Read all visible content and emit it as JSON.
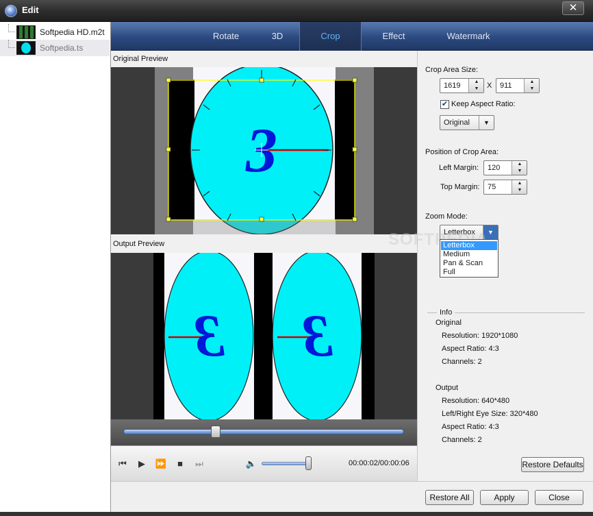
{
  "window": {
    "title": "Edit",
    "close_glyph": "✕"
  },
  "files": [
    {
      "name": "Softpedia HD.m2t",
      "thumb": "film-thumbnail"
    },
    {
      "name": "Softpedia.ts",
      "thumb": "clock-thumbnail"
    }
  ],
  "tabs": [
    {
      "label": "Rotate"
    },
    {
      "label": "3D"
    },
    {
      "label": "Crop",
      "active": true
    },
    {
      "label": "Effect"
    },
    {
      "label": "Watermark"
    }
  ],
  "preview": {
    "original_label": "Original Preview",
    "output_label": "Output Preview",
    "digit": "3",
    "seek_progress": 0.33,
    "volume_level": 0.95,
    "time": "00:00:02/00:00:06"
  },
  "crop": {
    "area_label": "Crop Area Size:",
    "width": "1619",
    "x_label": "X",
    "height": "911",
    "keep_aspect_label": "Keep Aspect Ratio:",
    "keep_aspect_checked": true,
    "aspect_value": "Original",
    "position_label": "Position of Crop Area:",
    "left_margin_label": "Left Margin:",
    "left_margin": "120",
    "top_margin_label": "Top Margin:",
    "top_margin": "75",
    "zoom_label": "Zoom Mode:",
    "zoom_value": "Letterbox",
    "zoom_options": [
      "Letterbox",
      "Medium",
      "Pan & Scan",
      "Full"
    ]
  },
  "info": {
    "title": "Info",
    "original_heading": "Original",
    "original": {
      "resolution": "Resolution: 1920*1080",
      "aspect": "Aspect Ratio: 4:3",
      "channels": "Channels: 2"
    },
    "output_heading": "Output",
    "output": {
      "resolution": "Resolution: 640*480",
      "eye_size": "Left/Right Eye Size: 320*480",
      "aspect": "Aspect Ratio: 4:3",
      "channels": "Channels: 2"
    }
  },
  "buttons": {
    "restore_defaults": "Restore Defaults",
    "restore_all": "Restore All",
    "apply": "Apply",
    "close": "Close"
  },
  "watermark_text": "SOFTPEDIA",
  "colors": {
    "accent": "#3399ff",
    "clock_face": "#00f0f8",
    "digit": "#0018d8",
    "hand": "#cc0000",
    "crop_frame": "#ffff00"
  }
}
